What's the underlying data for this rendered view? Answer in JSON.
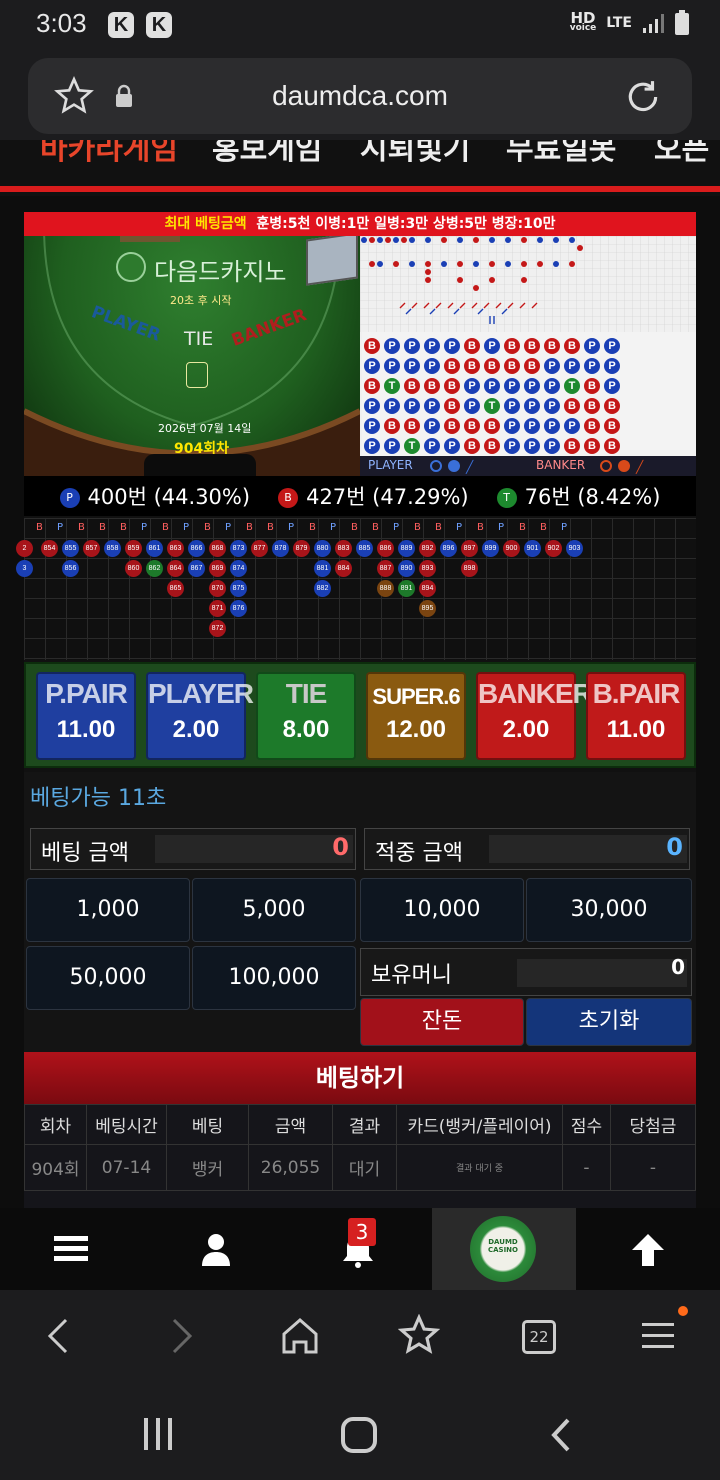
{
  "status_bar": {
    "time": "3:03",
    "badge1": "K",
    "badge2": "K",
    "hd": "HD",
    "voice": "voice",
    "lte": "LTE"
  },
  "browser": {
    "url": "daumdca.com"
  },
  "site_menu": {
    "items": [
      "바카라게임",
      "홍보게임",
      "시퇴빛기",
      "무료일봇",
      "오픈"
    ]
  },
  "game": {
    "banner_label": "최대 베팅금액",
    "banner_limits": "훈병:5천 이병:1만 일병:3만 상병:5만 병장:10만",
    "table": {
      "logo": "다음드카지노",
      "countdown": "20초 후 시작",
      "player_label": "PLAYER",
      "tie_label": "TIE",
      "banker_label": "BANKER",
      "date": "2026년 07월 14일",
      "round": "904회차"
    },
    "board_labels": {
      "player": "PLAYER",
      "banker": "BANKER"
    },
    "bead_rows": [
      [
        "B",
        "P",
        "P",
        "P",
        "P",
        "B",
        "P",
        "B",
        "B",
        "B",
        "B",
        "P",
        "P"
      ],
      [
        "P",
        "P",
        "P",
        "P",
        "B",
        "B",
        "B",
        "B",
        "B",
        "P",
        "P",
        "P",
        "P"
      ],
      [
        "B",
        "T",
        "B",
        "B",
        "B",
        "P",
        "P",
        "P",
        "P",
        "P",
        "T",
        "B",
        "P"
      ],
      [
        "P",
        "P",
        "P",
        "P",
        "B",
        "P",
        "T",
        "P",
        "P",
        "P",
        "B",
        "B",
        "B"
      ],
      [
        "P",
        "B",
        "B",
        "P",
        "B",
        "B",
        "B",
        "P",
        "P",
        "P",
        "P",
        "B",
        "B"
      ],
      [
        "P",
        "P",
        "T",
        "P",
        "P",
        "B",
        "B",
        "P",
        "P",
        "P",
        "B",
        "B",
        "B"
      ]
    ],
    "stats": {
      "p_icon": "P",
      "player": "400번 (44.30%)",
      "b_icon": "B",
      "banker": "427번 (47.29%)",
      "t_icon": "T",
      "tie": "76번 (8.42%)"
    },
    "road_headers": [
      "B",
      "P",
      "B",
      "B",
      "B",
      "P",
      "B",
      "P",
      "B",
      "P",
      "B",
      "B",
      "P",
      "B",
      "P",
      "B",
      "B",
      "P",
      "B",
      "B",
      "P",
      "B",
      "P",
      "B",
      "B",
      "P"
    ],
    "road_columns": [
      [
        {
          "n": "2",
          "c": "b"
        },
        {
          "n": "3",
          "c": "p"
        }
      ],
      [
        {
          "n": "854",
          "c": "b"
        }
      ],
      [
        {
          "n": "855",
          "c": "p"
        },
        {
          "n": "856",
          "c": "p"
        }
      ],
      [
        {
          "n": "857",
          "c": "b"
        }
      ],
      [
        {
          "n": "858",
          "c": "p"
        }
      ],
      [
        {
          "n": "859",
          "c": "b"
        },
        {
          "n": "860",
          "c": "b"
        }
      ],
      [
        {
          "n": "861",
          "c": "p"
        },
        {
          "n": "862",
          "c": "t"
        }
      ],
      [
        {
          "n": "863",
          "c": "b"
        },
        {
          "n": "864",
          "c": "b"
        },
        {
          "n": "865",
          "c": "b"
        }
      ],
      [
        {
          "n": "866",
          "c": "p"
        },
        {
          "n": "867",
          "c": "p"
        }
      ],
      [
        {
          "n": "868",
          "c": "b"
        },
        {
          "n": "869",
          "c": "b"
        },
        {
          "n": "870",
          "c": "b"
        },
        {
          "n": "871",
          "c": "b"
        },
        {
          "n": "872",
          "c": "b"
        }
      ],
      [
        {
          "n": "873",
          "c": "p"
        },
        {
          "n": "874",
          "c": "p"
        },
        {
          "n": "875",
          "c": "p"
        },
        {
          "n": "876",
          "c": "p"
        }
      ],
      [
        {
          "n": "877",
          "c": "b"
        }
      ],
      [
        {
          "n": "878",
          "c": "p"
        }
      ],
      [
        {
          "n": "879",
          "c": "b"
        }
      ],
      [
        {
          "n": "880",
          "c": "p"
        },
        {
          "n": "881",
          "c": "p"
        },
        {
          "n": "882",
          "c": "p"
        }
      ],
      [
        {
          "n": "883",
          "c": "b"
        },
        {
          "n": "884",
          "c": "b"
        }
      ],
      [
        {
          "n": "885",
          "c": "p"
        }
      ],
      [
        {
          "n": "886",
          "c": "b"
        },
        {
          "n": "887",
          "c": "b"
        },
        {
          "n": "888",
          "c": "o"
        }
      ],
      [
        {
          "n": "889",
          "c": "p"
        },
        {
          "n": "890",
          "c": "p"
        },
        {
          "n": "891",
          "c": "t"
        }
      ],
      [
        {
          "n": "892",
          "c": "b"
        },
        {
          "n": "893",
          "c": "b"
        },
        {
          "n": "894",
          "c": "b"
        },
        {
          "n": "895",
          "c": "o"
        }
      ],
      [
        {
          "n": "896",
          "c": "p"
        }
      ],
      [
        {
          "n": "897",
          "c": "b"
        },
        {
          "n": "898",
          "c": "b"
        }
      ],
      [
        {
          "n": "899",
          "c": "p"
        }
      ],
      [
        {
          "n": "900",
          "c": "b"
        }
      ],
      [
        {
          "n": "901",
          "c": "p"
        }
      ],
      [
        {
          "n": "902",
          "c": "b"
        }
      ],
      [
        {
          "n": "903",
          "c": "p"
        }
      ]
    ],
    "odds": [
      {
        "name": "P.PAIR",
        "value": "11.00",
        "color": "#1f3fa0"
      },
      {
        "name": "PLAYER",
        "value": "2.00",
        "color": "#1f3fa0"
      },
      {
        "name": "TIE",
        "value": "8.00",
        "color": "#1d7a2a"
      },
      {
        "name": "SUPER.6",
        "value": "12.00",
        "color": "#8a5a10"
      },
      {
        "name": "BANKER",
        "value": "2.00",
        "color": "#c01a1a"
      },
      {
        "name": "B.PAIR",
        "value": "11.00",
        "color": "#c01a1a"
      }
    ],
    "betting": {
      "timer": "베팅가능 11초",
      "bet_amount_label": "베팅 금액",
      "bet_amount_value": "0",
      "win_amount_label": "적중 금액",
      "win_amount_value": "0",
      "chips": [
        "1,000",
        "5,000",
        "10,000",
        "30,000",
        "50,000",
        "100,000"
      ],
      "balance_label": "보유머니",
      "balance_value": "0",
      "change_label": "잔돈",
      "reset_label": "초기화",
      "submit_label": "베팅하기"
    },
    "history": {
      "columns": [
        "회차",
        "베팅시간",
        "베팅",
        "금액",
        "결과",
        "카드(뱅커/플레이어)",
        "점수",
        "당첨금"
      ],
      "rows": [
        [
          "904회",
          "07-14",
          "뱅커",
          "26,055",
          "대기",
          "결과 대기 중",
          "-",
          "-"
        ]
      ]
    }
  },
  "bottom_nav": {
    "badge": "3",
    "logo_text": "DAUMD CASINO"
  },
  "browser_nav": {
    "tabs": "22"
  },
  "colors": {
    "accent_red": "#d91c1c",
    "player_blue": "#1a3fb5",
    "banker_red": "#c41818",
    "tie_green": "#1d8a2e"
  }
}
